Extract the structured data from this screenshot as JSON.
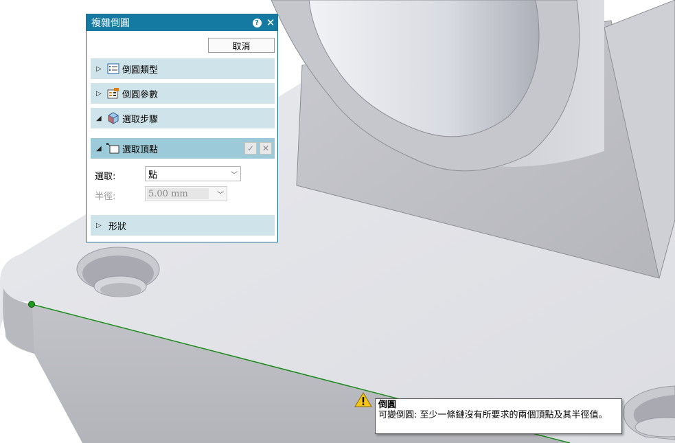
{
  "dialog": {
    "title": "複雜倒圓",
    "help_icon": "question-circle-icon",
    "close_icon": "close-icon",
    "cancel_label": "取消",
    "sections": [
      {
        "label": "倒圓類型",
        "expanded": false,
        "icon": "list-icon"
      },
      {
        "label": "倒圓參數",
        "expanded": false,
        "icon": "parameters-icon"
      },
      {
        "label": "選取步驟",
        "expanded": true,
        "icon": "cube-icon"
      },
      {
        "label": "選取頂點",
        "expanded": true,
        "icon": "vertex-select-icon"
      },
      {
        "label": "形狀",
        "expanded": false,
        "icon": ""
      }
    ],
    "fields": {
      "select_label": "選取:",
      "select_value": "點",
      "radius_label": "半徑:",
      "radius_value": "5.00 mm"
    }
  },
  "tooltip": {
    "title": "倒圓",
    "message": "可變倒圓: 至少一條鏈沒有所要求的兩個頂點及其半徑值。",
    "icon": "warning-icon"
  },
  "colors": {
    "titlebar": "#157aa2",
    "section": "#cfe4ea",
    "section_active": "#9ccad8",
    "edge_highlight": "#1a8a1a"
  }
}
